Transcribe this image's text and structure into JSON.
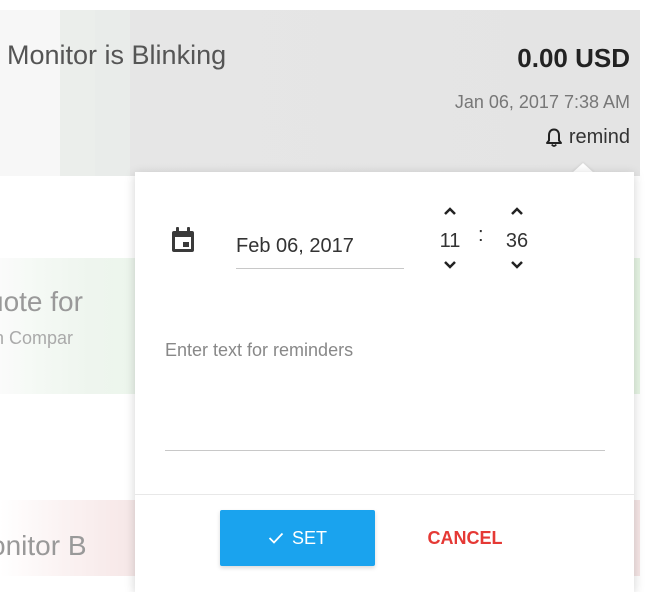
{
  "list": {
    "row1": {
      "title_faded": "y",
      "title": "Monitor is Blinking",
      "price": "0.00 USD",
      "date": "Jan 06, 2017 7:38 AM",
      "remind_label": "remind"
    },
    "row2": {
      "title": "uote for",
      "subtitle": "n Compar"
    },
    "row3": {
      "title": "onitor B"
    }
  },
  "reminder_popup": {
    "date_value": "Feb 06, 2017",
    "hour": "11",
    "minute": "36",
    "separator": ":",
    "note_placeholder": "Enter text for reminders",
    "note_value": "",
    "set_label": "SET",
    "cancel_label": "CANCEL"
  },
  "colors": {
    "primary_button": "#1aa3ee",
    "cancel_text": "#e53935",
    "row1_bg": "#e4e4e4",
    "row2_bg": "#e6f5e4",
    "row3_bg": "#f6e6e6"
  }
}
